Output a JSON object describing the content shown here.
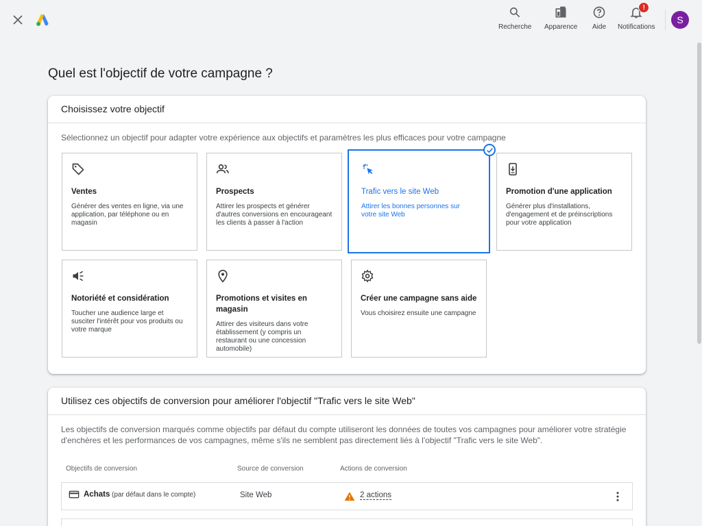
{
  "topbar": {
    "actions": [
      {
        "label": "Recherche",
        "icon": "search-icon"
      },
      {
        "label": "Apparence",
        "icon": "appearance-icon"
      },
      {
        "label": "Aide",
        "icon": "help-icon"
      },
      {
        "label": "Notifications",
        "icon": "bell-icon",
        "badge": "!"
      }
    ],
    "avatar_letter": "S"
  },
  "page_title": "Quel est l'objectif de votre campagne ?",
  "objective_card": {
    "header": "Choisissez votre objectif",
    "description": "Sélectionnez un objectif pour adapter votre expérience aux objectifs et paramètres les plus efficaces pour votre campagne",
    "goals": [
      {
        "title": "Ventes",
        "desc": "Générer des ventes en ligne, via une application, par téléphone ou en magasin",
        "icon": "tag-icon",
        "selected": false
      },
      {
        "title": "Prospects",
        "desc": "Attirer les prospects et générer d'autres conversions en encourageant les clients à passer à l'action",
        "icon": "people-icon",
        "selected": false
      },
      {
        "title": "Trafic vers le site Web",
        "desc": "Attirer les bonnes personnes sur votre site Web",
        "icon": "cursor-click-icon",
        "selected": true
      },
      {
        "title": "Promotion d'une application",
        "desc": "Générer plus d'installations, d'engagement et de préinscriptions pour votre application",
        "icon": "phone-download-icon",
        "selected": false
      },
      {
        "title": "Notoriété et considération",
        "desc": "Toucher une audience large et susciter l'intérêt pour vos produits ou votre marque",
        "icon": "speaker-icon",
        "selected": false
      },
      {
        "title": "Promotions et visites en magasin",
        "desc": "Attirer des visiteurs dans votre établissement (y compris un restaurant ou une concession automobile)",
        "icon": "location-pin-icon",
        "selected": false
      },
      {
        "title": "Créer une campagne sans aide",
        "desc": "Vous choisirez ensuite une campagne",
        "icon": "gear-icon",
        "selected": false
      }
    ]
  },
  "conversion_card": {
    "header": "Utilisez ces objectifs de conversion pour améliorer l'objectif \"Trafic vers le site Web\"",
    "description": "Les objectifs de conversion marqués comme objectifs par défaut du compte utiliseront les données de toutes vos campagnes pour améliorer votre stratégie d'enchères et les performances de vos campagnes, même s'ils ne semblent pas directement liés à l'objectif \"Trafic vers le site Web\".",
    "columns": [
      "Objectifs de conversion",
      "Source de conversion",
      "Actions de conversion"
    ],
    "rows": [
      {
        "name": "Achats",
        "note": "(par défaut dans le compte)",
        "source": "Site Web",
        "actions": "2 actions"
      }
    ]
  },
  "colors": {
    "accent": "#1a73e8",
    "warning": "#e37400",
    "avatar": "#7b1fa2",
    "badge": "#d93025"
  }
}
